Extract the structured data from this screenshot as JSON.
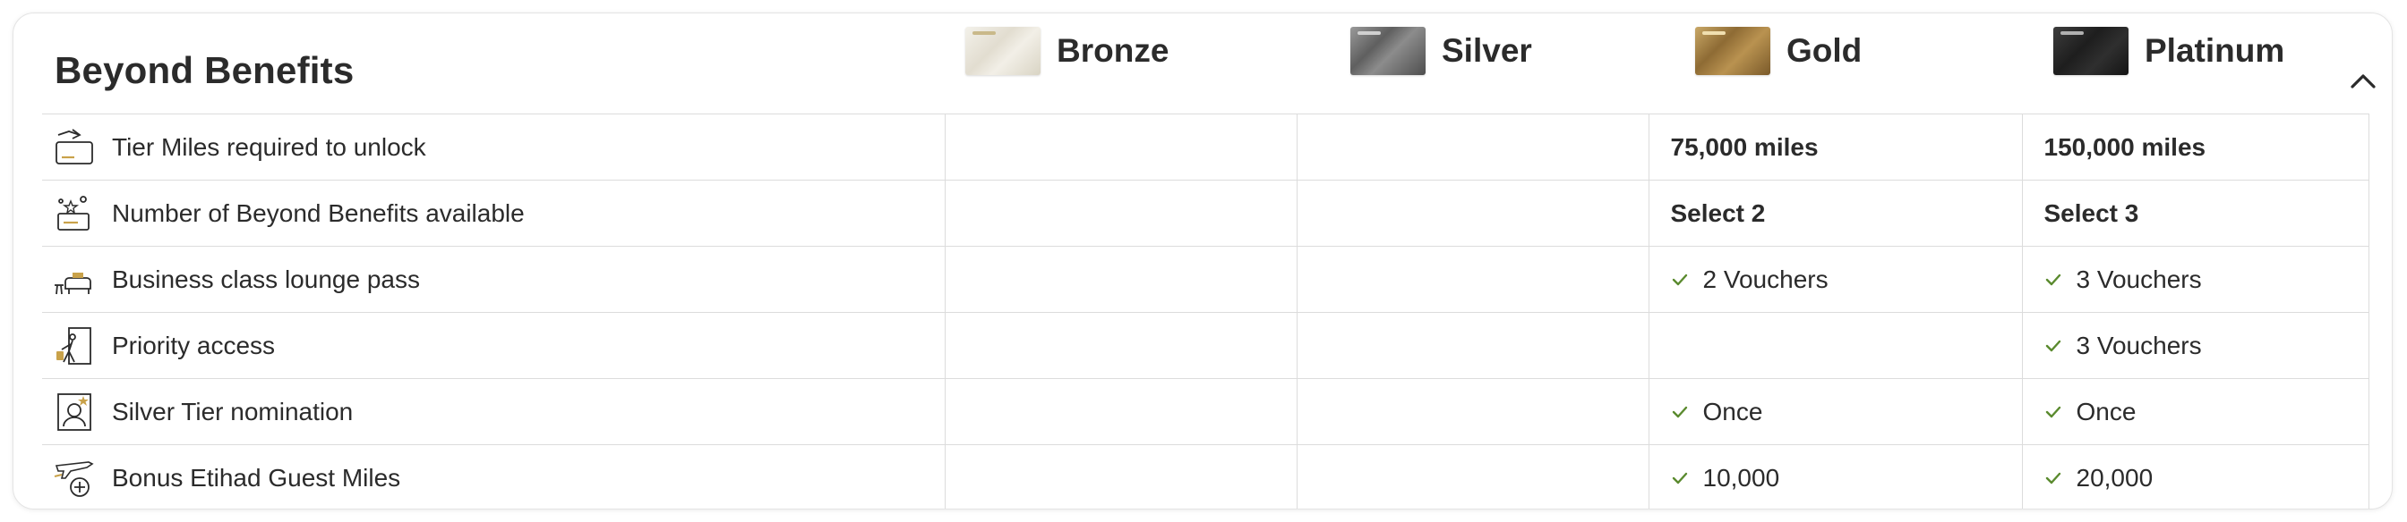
{
  "title": "Beyond Benefits",
  "tiers": [
    {
      "name": "Bronze",
      "card_color": "#ece8dc"
    },
    {
      "name": "Silver",
      "card_color": "#6e6e6e"
    },
    {
      "name": "Gold",
      "card_color": "#a8843f"
    },
    {
      "name": "Platinum",
      "card_color": "#222222"
    }
  ],
  "collapse_icon": "chevron-up-icon",
  "accent_check_color": "#5a8a2e",
  "rows": [
    {
      "icon": "tier-card-upgrade-icon",
      "label": "Tier Miles required to unlock",
      "values": [
        "",
        "",
        "75,000 miles",
        "150,000 miles"
      ],
      "style": "bold"
    },
    {
      "icon": "benefits-select-icon",
      "label": "Number of Beyond Benefits available",
      "values": [
        "",
        "",
        "Select 2",
        "Select 3"
      ],
      "style": "bold"
    },
    {
      "icon": "lounge-seat-icon",
      "label": "Business class lounge pass",
      "values": [
        "",
        "",
        "2 Vouchers",
        "3 Vouchers"
      ],
      "style": "check"
    },
    {
      "icon": "priority-access-icon",
      "label": "Priority access",
      "values": [
        "",
        "",
        "",
        "3 Vouchers"
      ],
      "style": "check"
    },
    {
      "icon": "tier-nomination-icon",
      "label": "Silver Tier nomination",
      "values": [
        "",
        "",
        "Once",
        "Once"
      ],
      "style": "check"
    },
    {
      "icon": "plane-plus-miles-icon",
      "label": "Bonus Etihad Guest Miles",
      "values": [
        "",
        "",
        "10,000",
        "20,000"
      ],
      "style": "check"
    }
  ]
}
